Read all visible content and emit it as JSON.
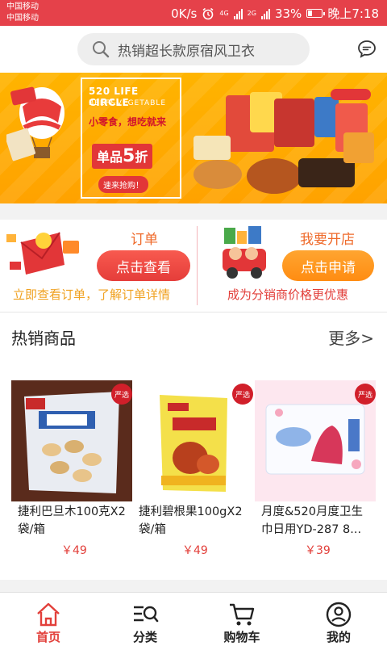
{
  "status": {
    "carrier1": "中国移动",
    "carrier2": "中国移动",
    "speed": "0K/s",
    "net1": "4G",
    "net2": "2G",
    "battery": "33%",
    "time": "晚上7:18"
  },
  "search": {
    "placeholder": "热销超长款原宿风卫衣"
  },
  "banner": {
    "title": "520 LIFE CIRCLE",
    "subtitle": "BEEF&VEGETABLE",
    "slogan": "小零食，想吃就来",
    "deal_prefix": "单品",
    "deal_value": "5",
    "deal_suffix": "折",
    "cta": "速来抢购！"
  },
  "orders": {
    "title": "订单",
    "button": "点击查看",
    "desc": "立即查看订单，了解订单详情"
  },
  "shop": {
    "title": "我要开店",
    "button": "点击申请",
    "desc": "成为分销商价格更优惠"
  },
  "hot": {
    "title": "热销商品",
    "more": "更多>",
    "badge": "严选",
    "products": [
      {
        "name": "捷利巴旦木100克X2袋/箱",
        "price": "￥49"
      },
      {
        "name": "捷利碧根果100gX2袋/箱",
        "price": "￥49"
      },
      {
        "name": "月度&520月度卫生巾日用YD-287 8...",
        "price": "￥39"
      }
    ]
  },
  "tabs": [
    {
      "label": "首页",
      "active": true
    },
    {
      "label": "分类"
    },
    {
      "label": "购物车"
    },
    {
      "label": "我的"
    }
  ],
  "colors": {
    "accent": "#e23f3a",
    "status_bar": "#e5414a",
    "banner": "#ffa800",
    "orange": "#ff8c12"
  }
}
